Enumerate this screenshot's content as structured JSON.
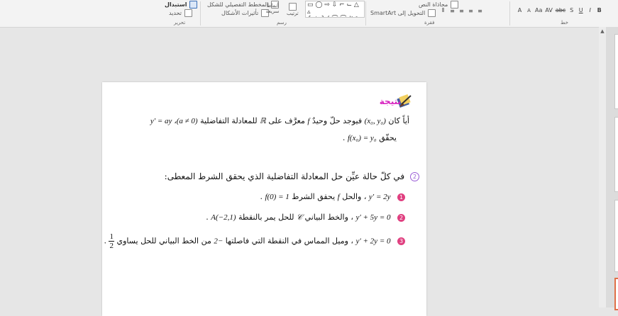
{
  "ribbon": {
    "edit_group": {
      "label": "تحرير",
      "replace": "استبدال",
      "select": "تحديد"
    },
    "draw_group": {
      "label": "رسم",
      "shape_outline": "المخطط التفصيلي للشكل",
      "shape_effects": "تأثيرات الأشكال",
      "quick_styles": "أنماط سريعة",
      "arrange": "ترتيب"
    },
    "paragraph_group": {
      "label": "فقرة",
      "text_direction": "محاذاة النص",
      "convert_smartart": "التحويل إلى SmartArt"
    },
    "font_group": {
      "label": "خط",
      "font_size_up": "A",
      "font_size_down": "A",
      "clear": "Aa",
      "spacing": "AV",
      "shadow": "abc",
      "strike": "S",
      "underline": "U",
      "italic": "I",
      "bold": "B"
    }
  },
  "slide": {
    "result_title": "نتيجة",
    "theorem_line1_text": "أياً كان",
    "theorem_line1_math1": "(x₀, y₀)",
    "theorem_line1_text2": "فيوجد حلّ وحيدٌ",
    "theorem_line1_f": "f",
    "theorem_line1_text3": "معرَّف على",
    "theorem_line1_R": "ℝ",
    "theorem_line1_text4": "للمعادلة التفاضلية",
    "theorem_line1_math2": "y′ = ay ،(a ≠ 0)",
    "theorem_line2_text": "يحقّق",
    "theorem_line2_math": "f(x₀) = y₀",
    "exercise_num": "2",
    "exercise_text": "في كلّ حالة عيِّن حل المعادلة التفاضلية الذي يحقق الشرط المعطى:",
    "items": [
      {
        "num": "1",
        "eq": "y′ = 2y",
        "text": "، والحل",
        "f": "f",
        "cond_text": "يحقق الشرط",
        "cond": "f(0) = 1"
      },
      {
        "num": "2",
        "eq": "y′ + 5y = 0",
        "text": "، والخط البياني",
        "f": "𝒞",
        "cond_text": "للحل يمر بالنقطة",
        "cond": "A(−2,1)"
      },
      {
        "num": "3",
        "eq": "y′ + 2y = 0",
        "text": "، وميل المماس في النقطة التي فاصلتها",
        "f": "−2",
        "cond_text": "من الخط البياني للحل يساوي",
        "cond_num": "1",
        "cond_den": "2"
      }
    ]
  },
  "colors": {
    "accent_title": "#d61fbf",
    "item_circle": "#e04080",
    "exercise_circle": "#9a5cd6",
    "active_thumb": "#e07048"
  }
}
